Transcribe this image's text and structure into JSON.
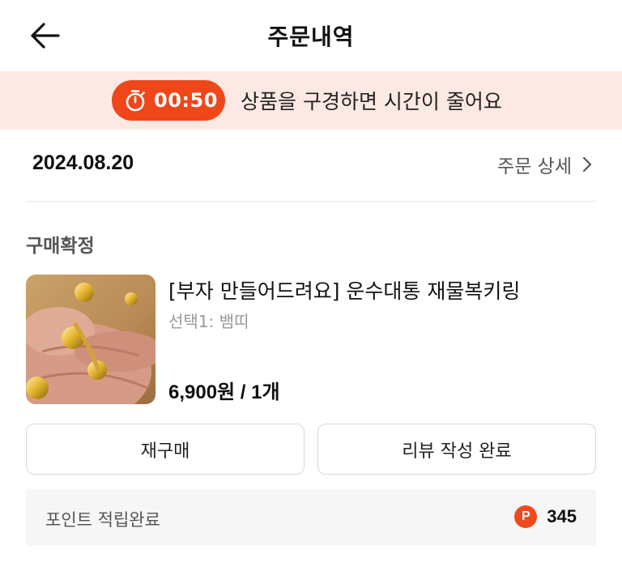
{
  "header": {
    "title": "주문내역"
  },
  "timer_banner": {
    "time": "00:50",
    "message": "상품을 구경하면 시간이 줄어요",
    "accent_color": "#f0471a",
    "background_color": "#fde9e4"
  },
  "order": {
    "date": "2024.08.20",
    "detail_link_label": "주문 상세",
    "status": "구매확정",
    "product": {
      "name": "[부자 만들어드려요] 운수대통 재물복키링",
      "option": "선택1: 뱀띠",
      "price": "6,900원 / 1개"
    },
    "buttons": {
      "rebuy_label": "재구매",
      "review_label": "리뷰 작성 완료"
    },
    "points": {
      "label": "포인트 적립완료",
      "icon_letter": "P",
      "value": "345"
    }
  }
}
